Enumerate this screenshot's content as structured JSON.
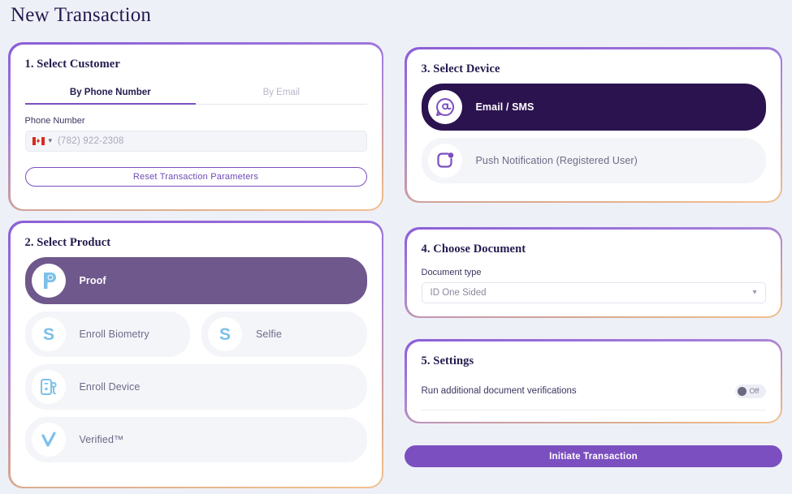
{
  "page": {
    "title": "New Transaction",
    "background_color": "#eef0f8",
    "accent_purple": "#7b4fc0",
    "accent_dark_purple": "#2b134f",
    "accent_peach": "#f3c18e",
    "icon_blue": "#7cc0ea"
  },
  "customer": {
    "title": "1. Select Customer",
    "tabs": [
      {
        "label": "By Phone Number",
        "active": true
      },
      {
        "label": "By Email",
        "active": false
      }
    ],
    "phone_label": "Phone Number",
    "phone_placeholder": "(782) 922-2308",
    "phone_value": "",
    "country_flag": "canada-flag-icon",
    "reset_label": "Reset Transaction Parameters"
  },
  "product": {
    "title": "2. Select Product",
    "items": [
      {
        "label": "Proof",
        "icon": "proof-p-icon",
        "selected": true
      },
      {
        "label": "Enroll Biometry",
        "icon": "biometry-s-icon",
        "selected": false
      },
      {
        "label": "Selfie",
        "icon": "selfie-s-icon",
        "selected": false
      },
      {
        "label": "Enroll Device",
        "icon": "enroll-device-icon",
        "selected": false
      },
      {
        "label": "Verified™",
        "icon": "verified-check-icon",
        "selected": false
      }
    ]
  },
  "device": {
    "title": "3. Select Device",
    "items": [
      {
        "label": "Email / SMS",
        "icon": "email-sms-icon",
        "selected": true
      },
      {
        "label": "Push Notification (Registered User)",
        "icon": "push-notification-icon",
        "selected": false
      }
    ]
  },
  "document": {
    "title": "4. Choose Document",
    "field_label": "Document type",
    "selected_value": "ID One Sided"
  },
  "settings": {
    "title": "5. Settings",
    "rows": [
      {
        "label": "Run additional document verifications",
        "toggle_state": "Off",
        "on": false
      }
    ]
  },
  "actions": {
    "initiate_label": "Initiate Transaction"
  }
}
